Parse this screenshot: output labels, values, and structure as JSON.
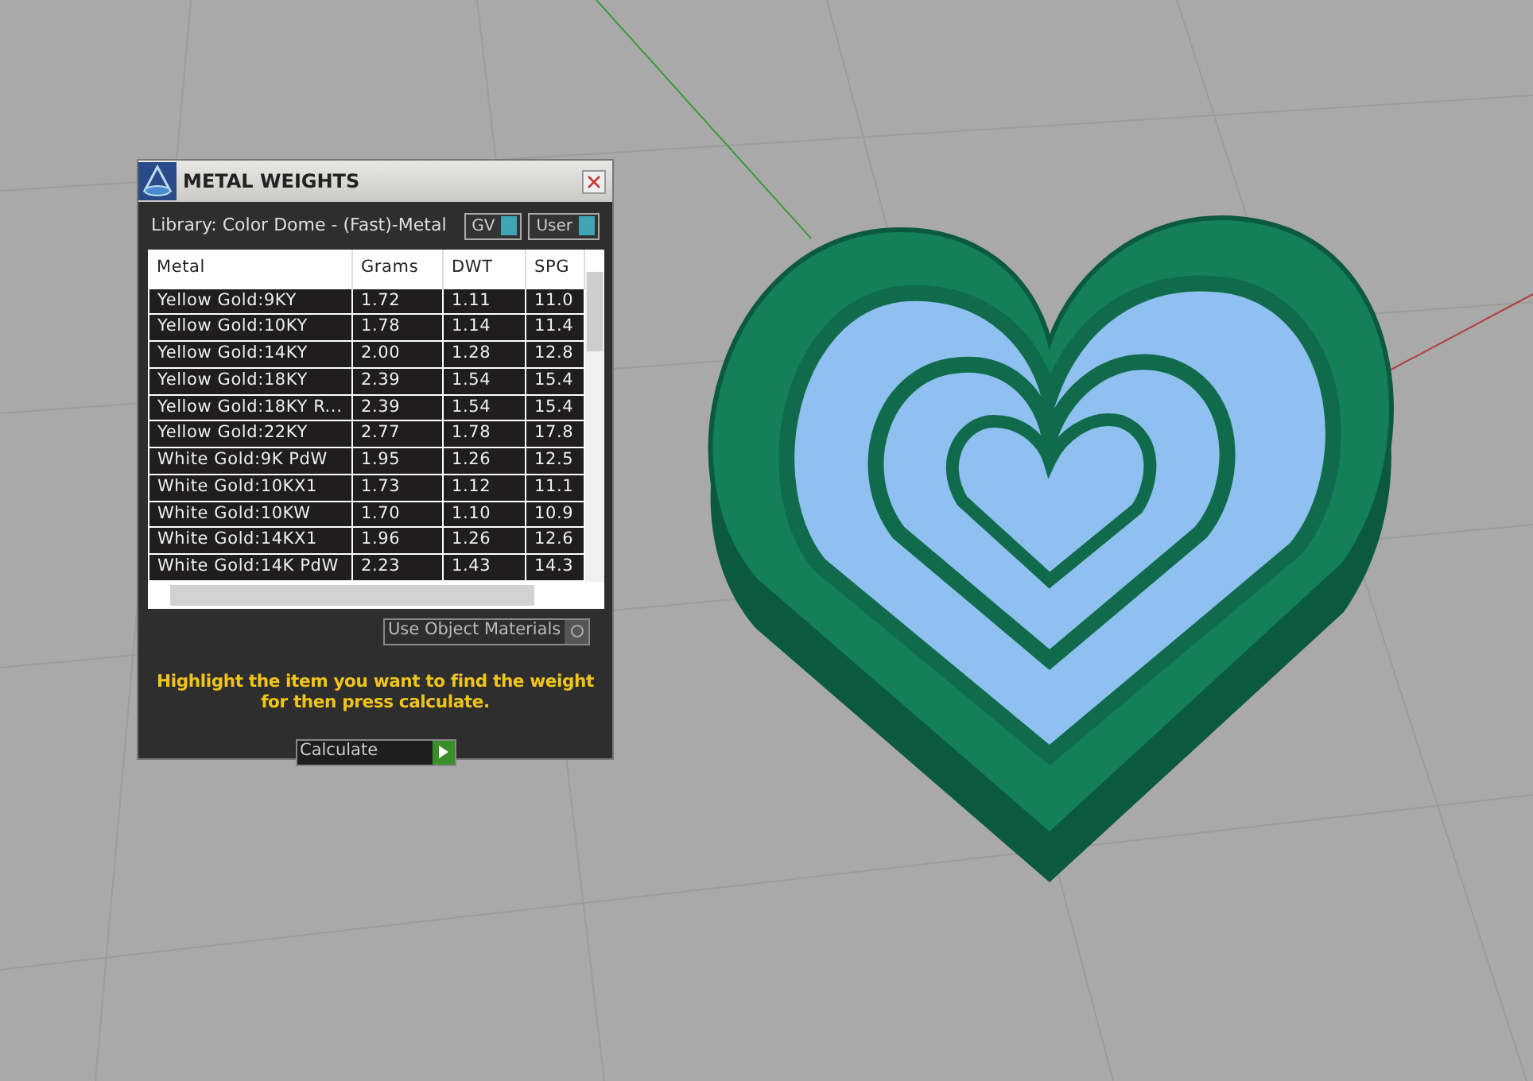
{
  "panel": {
    "title": "METAL WEIGHTS",
    "library": "Library: Color Dome - (Fast)-Metal",
    "toggles": [
      {
        "label": "GV",
        "on": true
      },
      {
        "label": "User",
        "on": true
      }
    ],
    "table": {
      "columns": [
        "Metal",
        "Grams",
        "DWT",
        "SPG"
      ],
      "rows": [
        [
          "Yellow Gold:9KY",
          "1.72",
          "1.11",
          "11.0"
        ],
        [
          "Yellow Gold:10KY",
          "1.78",
          "1.14",
          "11.4"
        ],
        [
          "Yellow Gold:14KY",
          "2.00",
          "1.28",
          "12.8"
        ],
        [
          "Yellow Gold:18KY",
          "2.39",
          "1.54",
          "15.4"
        ],
        [
          "Yellow Gold:18KY R...",
          "2.39",
          "1.54",
          "15.4"
        ],
        [
          "Yellow Gold:22KY",
          "2.77",
          "1.78",
          "17.8"
        ],
        [
          "White Gold:9K PdW",
          "1.95",
          "1.26",
          "12.5"
        ],
        [
          "White Gold:10KX1",
          "1.73",
          "1.12",
          "11.1"
        ],
        [
          "White Gold:10KW",
          "1.70",
          "1.10",
          "10.9"
        ],
        [
          "White Gold:14KX1",
          "1.96",
          "1.26",
          "12.6"
        ],
        [
          "White Gold:14K PdW",
          "2.23",
          "1.43",
          "14.3"
        ]
      ]
    },
    "option": {
      "label": "Use Object Materials",
      "checked": false
    },
    "hint": "Highlight the item you want to find the weight for then press calculate.",
    "button": "Calculate"
  }
}
